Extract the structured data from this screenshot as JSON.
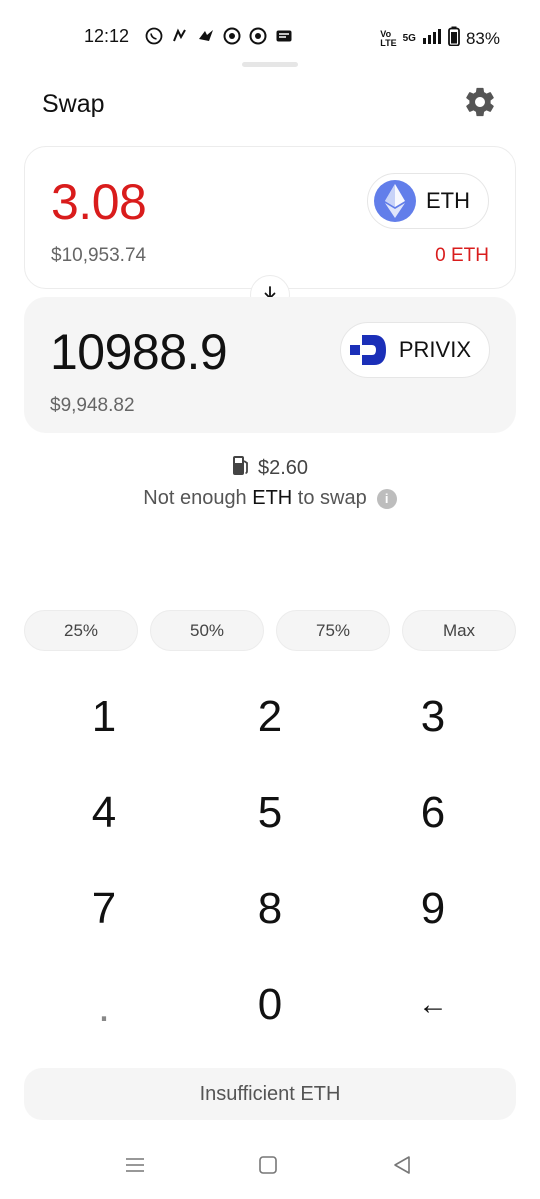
{
  "status_bar": {
    "time": "12:12",
    "network": "5G",
    "battery": "83%",
    "notification_icons": [
      "whatsapp-icon",
      "app-icon",
      "app-icon",
      "chrome-icon",
      "chrome-icon",
      "gmail-icon"
    ]
  },
  "header": {
    "title": "Swap",
    "settings_icon": "gear-icon"
  },
  "sell": {
    "amount": "3.08",
    "fiat_value": "$10,953.74",
    "token_symbol": "ETH",
    "balance": "0 ETH",
    "color": "#d91c1c"
  },
  "buy": {
    "amount": "10988.9",
    "fiat_value": "$9,948.82",
    "token_symbol": "PRIVIX"
  },
  "gas": {
    "icon": "gas-pump-icon",
    "fee": "$2.60"
  },
  "warning": {
    "prefix": "Not enough ",
    "token": "ETH",
    "suffix": " to swap"
  },
  "percent_buttons": [
    "25%",
    "50%",
    "75%",
    "Max"
  ],
  "keypad": {
    "keys": [
      "1",
      "2",
      "3",
      "4",
      "5",
      "6",
      "7",
      "8",
      "9",
      ".",
      "0",
      "←"
    ]
  },
  "cta": {
    "label": "Insufficient ETH"
  },
  "colors": {
    "accent_red": "#d91c1c",
    "eth_blue": "#627eea",
    "privix_blue": "#1b2fb8"
  }
}
